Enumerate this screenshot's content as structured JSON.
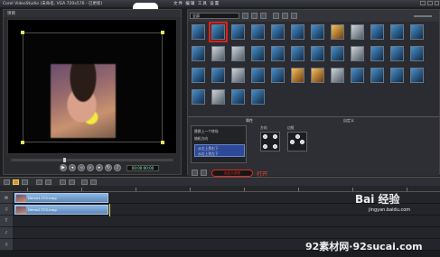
{
  "titlebar": {
    "title": "Corel VideoStudio (未命名, VGA 720x576 - 已更新)",
    "menu": "文件  编辑  工具  设置"
  },
  "preview": {
    "label": "项目",
    "timecode": "00:00:00:00"
  },
  "library": {
    "dropdown": "全部"
  },
  "effect_panel": {
    "tab_attribute": "属性",
    "tab_option": "自定义",
    "option_title": "替换上一个转场",
    "option_item1": "随机方向",
    "list_item1": "从左上到右下",
    "list_item2": "从右上到左下",
    "dir_label": "方向",
    "border_label": "边框",
    "open_label": "自定义滤镜",
    "open_text": "打开"
  },
  "tracks": [
    {
      "icon": "▤",
      "clip": "Demo1-TCS.mpg"
    },
    {
      "icon": "♫",
      "clip": "Demo2-TCS.mpg"
    },
    {
      "icon": "T",
      "clip": ""
    },
    {
      "icon": "♪",
      "clip": ""
    },
    {
      "icon": "♫",
      "clip": ""
    }
  ],
  "watermarks": {
    "baidu": "Bai 经验",
    "baidu_url": "jingyan.baidu.com",
    "site": "92素材网·92sucai.com"
  },
  "colors": {
    "highlight_red": "#e02a20",
    "clip_blue": "#8db7e3",
    "playhead": "#e6e25a"
  }
}
